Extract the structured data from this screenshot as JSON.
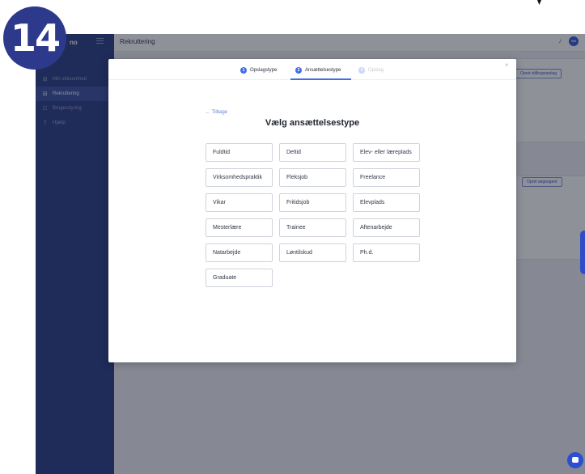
{
  "app": {
    "brand": "no",
    "topbar_title": "Rekruttering",
    "avatar_initials": "NN"
  },
  "sidebar": {
    "items": [
      {
        "label": "Min virksomhed",
        "icon": "building-icon",
        "active": false
      },
      {
        "label": "Rekruttering",
        "icon": "briefcase-icon",
        "active": true
      },
      {
        "label": "Brugerstyring",
        "icon": "users-icon",
        "active": false
      },
      {
        "label": "Hjælp",
        "icon": "help-icon",
        "active": false
      }
    ]
  },
  "background_buttons": {
    "create_job_posting": "Opret stillingsopslag",
    "create_search_agent": "Opret søgeagent"
  },
  "step_badge": "14",
  "modal": {
    "steps": [
      {
        "number": "1",
        "label": "Opslagstype"
      },
      {
        "number": "2",
        "label": "Ansættelsestype"
      },
      {
        "number": "3",
        "label": "Opslag"
      }
    ],
    "active_step": 2,
    "back_label": "← Tilbage",
    "heading": "Vælg ansættelsestype",
    "close_label": "×",
    "options": [
      "Fuldtid",
      "Deltid",
      "Elev- eller læreplads",
      "Virksomhedspraktik",
      "Fleksjob",
      "Freelance",
      "Vikar",
      "Fritidsjob",
      "Elevplads",
      "Mesterlære",
      "Trainee",
      "Aftenarbejde",
      "Natarbejde",
      "Løntilskud",
      "Ph.d.",
      "Graduate"
    ]
  },
  "colors": {
    "sidebar": "#2c3f86",
    "accent": "#3f6fe8",
    "badge": "#2d3a8c"
  }
}
